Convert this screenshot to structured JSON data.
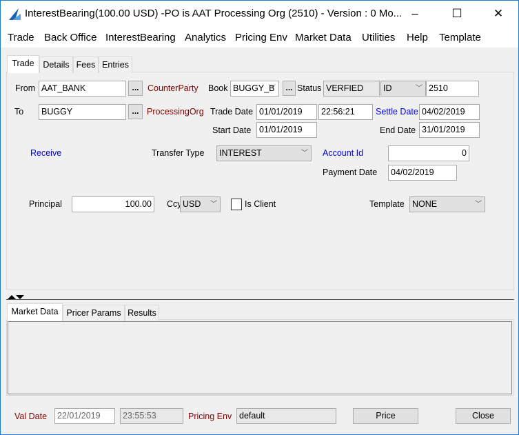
{
  "window": {
    "title": "InterestBearing(100.00 USD)  -PO is AAT Processing Org  (2510) - Version : 0 Mo...",
    "minimize": "–",
    "maximize": "☐",
    "close": "✕"
  },
  "menu": [
    "Trade",
    "Back Office",
    "InterestBearing",
    "Analytics",
    "Pricing Env",
    "Market Data",
    "Utilities",
    "Help",
    "Template"
  ],
  "tabs": [
    "Trade",
    "Details",
    "Fees",
    "Entries"
  ],
  "form": {
    "from_label": "From",
    "from_value": "AAT_BANK",
    "counterparty_label": "CounterParty",
    "book_label": "Book",
    "book_value": "BUGGY_B",
    "status_label": "Status",
    "status_value": "VERFIED",
    "id_type": "ID",
    "id_value": "2510",
    "to_label": "To",
    "to_value": "BUGGY",
    "processing_org_label": "ProcessingOrg",
    "trade_date_label": "Trade Date",
    "trade_date": "01/01/2019",
    "trade_time": "22:56:21",
    "settle_date_label": "Settle Date",
    "settle_date": "04/02/2019",
    "start_date_label": "Start Date",
    "start_date": "01/01/2019",
    "end_date_label": "End Date",
    "end_date": "31/01/2019",
    "direction": "Receive",
    "transfer_type_label": "Transfer Type",
    "transfer_type": "INTEREST",
    "account_id_label": "Account Id",
    "account_id": "0",
    "payment_date_label": "Payment Date",
    "payment_date": "04/02/2019",
    "principal_label": "Principal",
    "principal": "100.00",
    "ccy_label": "Ccy",
    "ccy": "USD",
    "is_client_label": "Is Client",
    "template_label": "Template",
    "template": "NONE",
    "dots": "..."
  },
  "lower_tabs": [
    "Market Data",
    "Pricer Params",
    "Results"
  ],
  "footer": {
    "val_date_label": "Val Date",
    "val_date": "22/01/2019",
    "val_time": "23:55:53",
    "pricing_env_label": "Pricing Env",
    "pricing_env": "default",
    "price_button": "Price",
    "close_button": "Close"
  },
  "colors": {
    "border": "#1a7bd0",
    "link_blue": "#0000ee",
    "label_red": "#800000"
  }
}
